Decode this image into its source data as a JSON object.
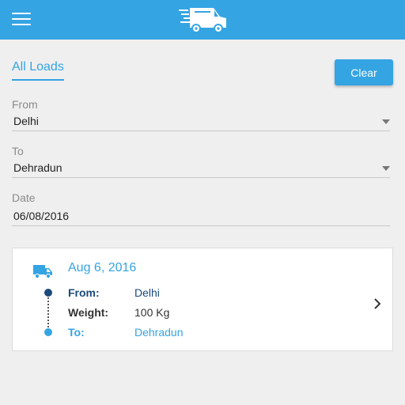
{
  "header": {
    "menu_icon": "hamburger-menu-icon",
    "logo_icon": "delivery-truck-icon",
    "color": "#34a4e3"
  },
  "tabs": {
    "all_loads": "All Loads"
  },
  "actions": {
    "clear_label": "Clear"
  },
  "filters": {
    "from": {
      "label": "From",
      "value": "Delhi"
    },
    "to": {
      "label": "To",
      "value": "Dehradun"
    },
    "date": {
      "label": "Date",
      "value": "06/08/2016"
    }
  },
  "loads": [
    {
      "date": "Aug 6, 2016",
      "from_label": "From:",
      "from_value": "Delhi",
      "weight_label": "Weight:",
      "weight_value": "100 Kg",
      "to_label": "To:",
      "to_value": "Dehradun",
      "icon": "truck-icon",
      "from_color": "#1a4a7a",
      "to_color": "#34a4e3"
    }
  ]
}
